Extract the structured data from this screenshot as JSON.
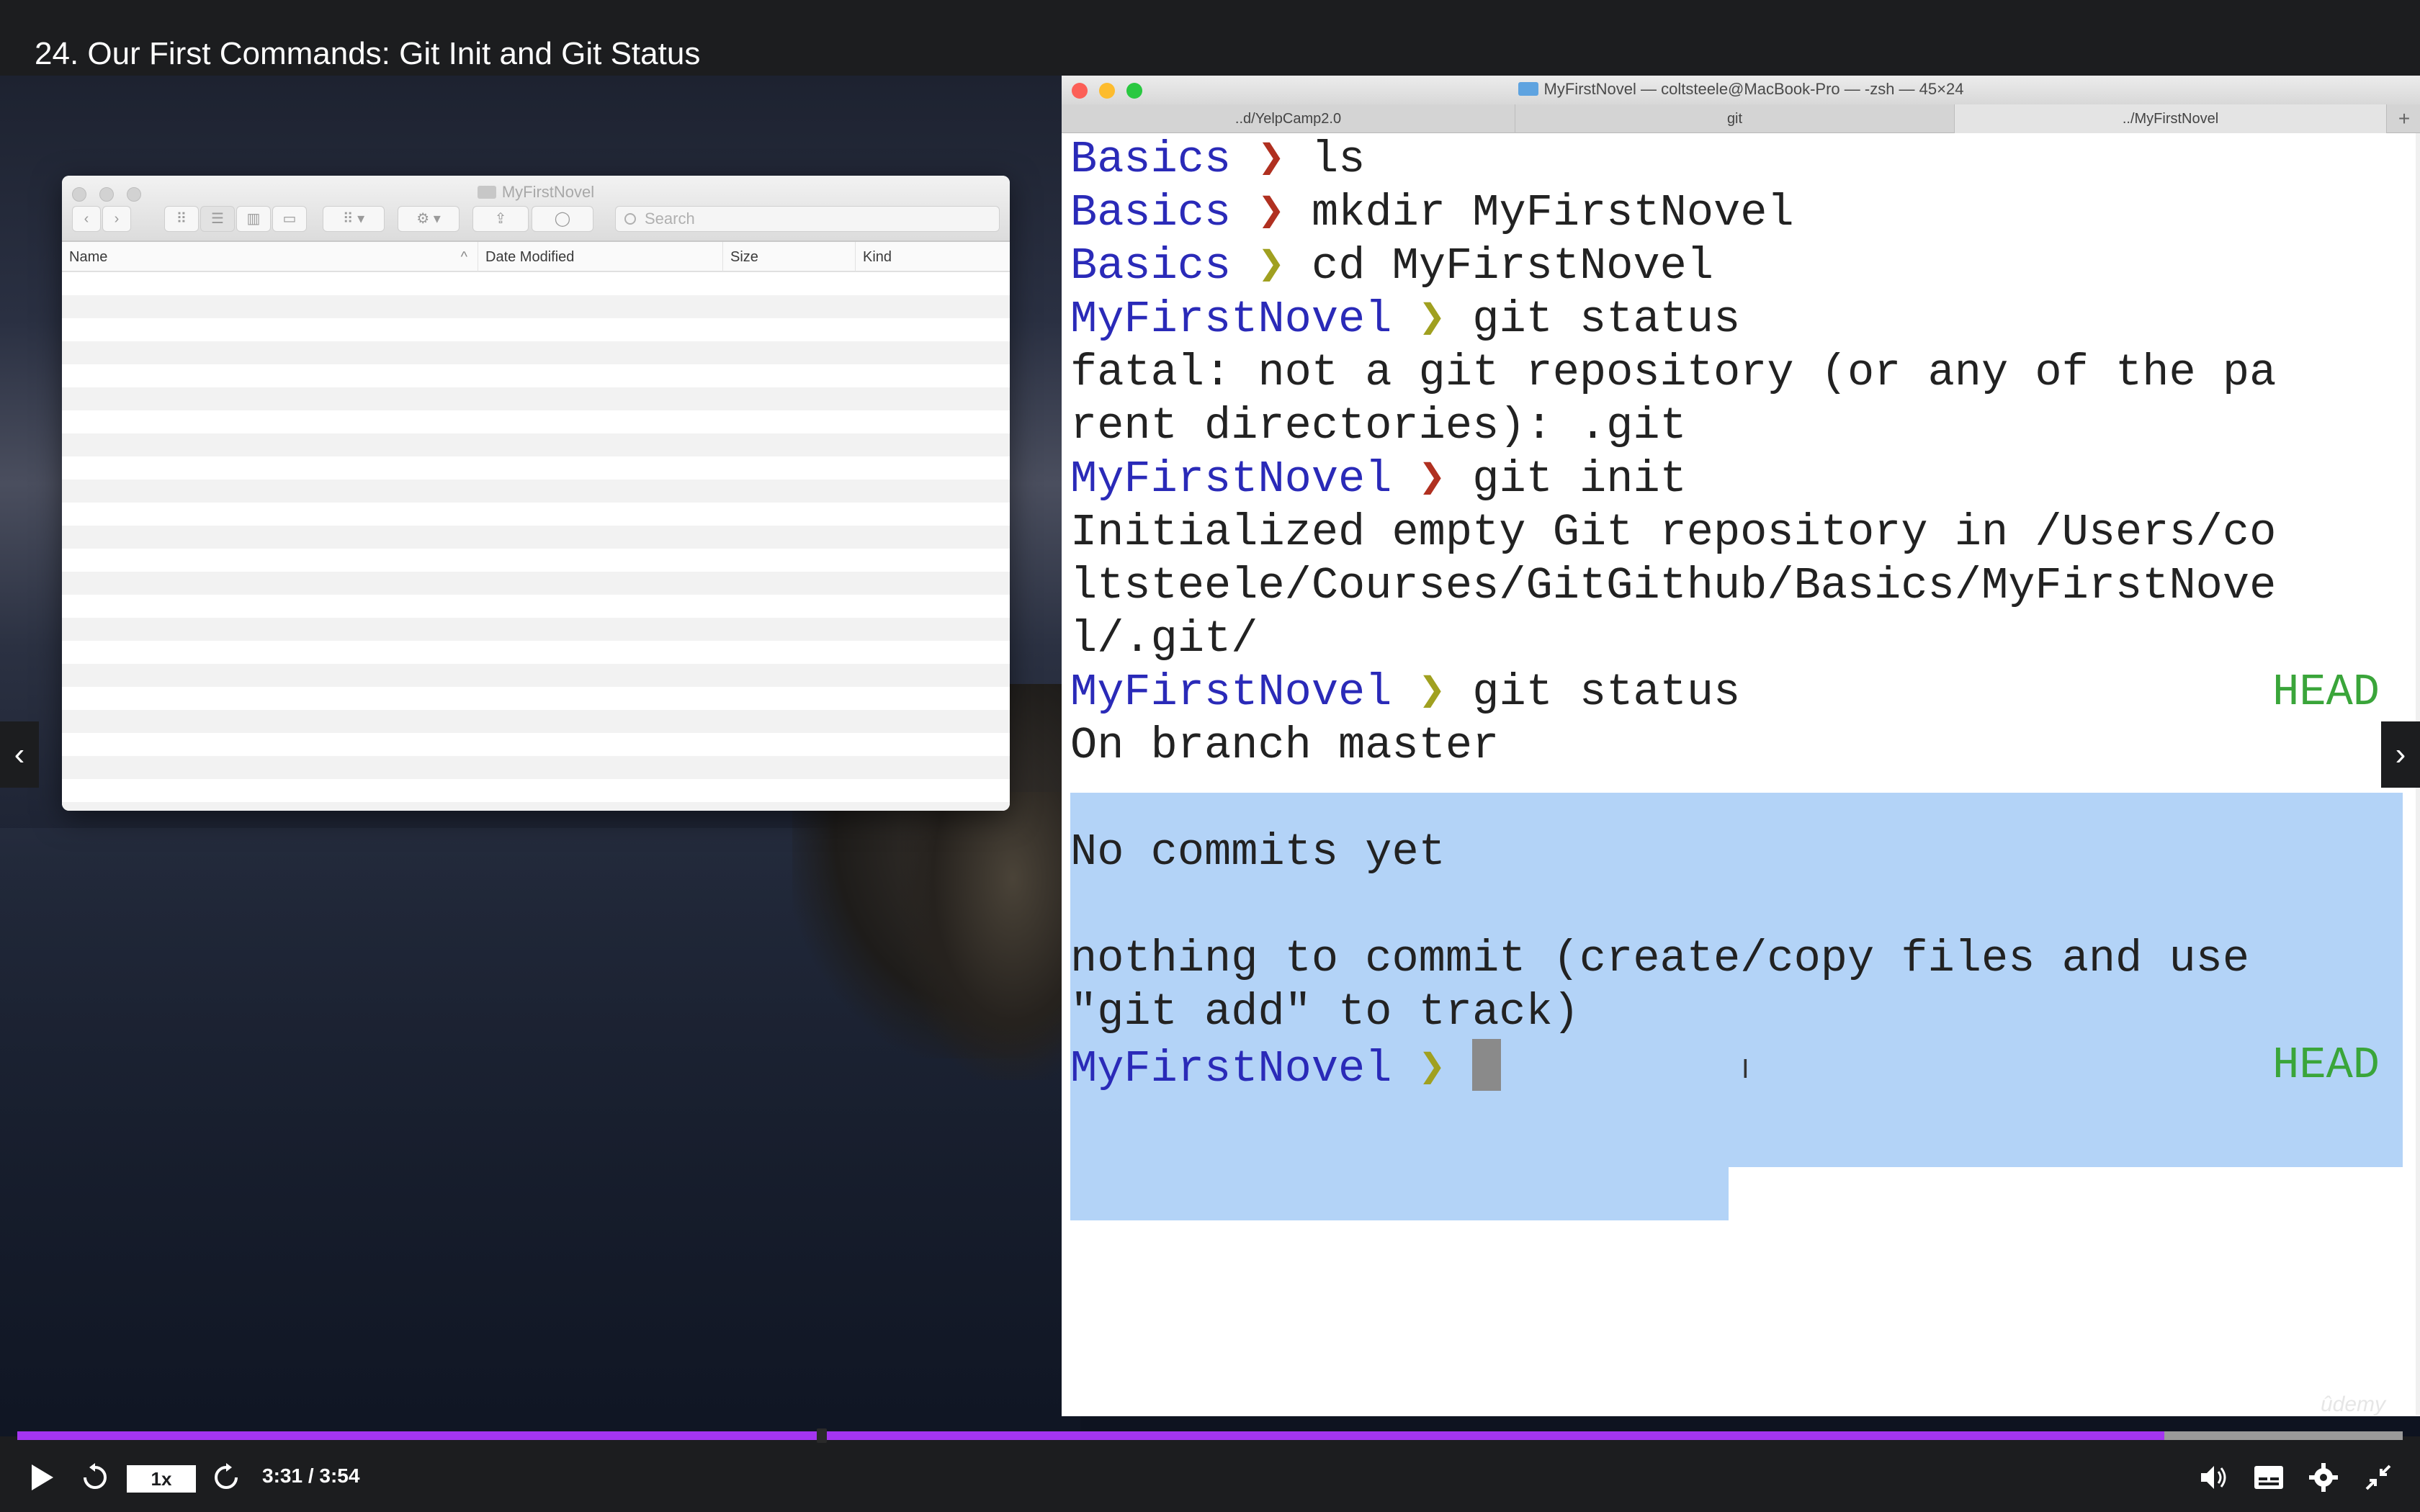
{
  "video": {
    "title": "24. Our First Commands: Git Init and Git Status",
    "time": "3:31 / 3:54",
    "speed": "1x",
    "progress_fraction": 0.9,
    "buffer_fraction": 1.0,
    "accent_color": "#a435f0",
    "watermark": "ûdemy"
  },
  "finder": {
    "title": "MyFirstNovel",
    "search_placeholder": "Search",
    "columns": [
      "Name",
      "Date Modified",
      "Size",
      "Kind"
    ],
    "sort_indicator": "^"
  },
  "terminal": {
    "title": "MyFirstNovel — coltsteele@MacBook-Pro — -zsh — 45×24",
    "tabs": [
      "..d/YelpCamp2.0",
      "git",
      "../MyFirstNovel"
    ],
    "tab_add": "+",
    "lines": [
      {
        "dir": "Basics",
        "arrow": "❯",
        "cmd": " ls"
      },
      {
        "dir": "Basics",
        "arrow": "❯",
        "cmd": " mkdir MyFirstNovel"
      },
      {
        "dir": "Basics",
        "arrow": "❯",
        "cmd": " cd MyFirstNovel"
      },
      {
        "dir": "MyFirstNovel",
        "arrow": "❯",
        "cmd": " git status"
      },
      {
        "text": "fatal: not a git repository (or any of the pa"
      },
      {
        "text": "rent directories): .git"
      },
      {
        "dir": "MyFirstNovel",
        "arrow": "❯",
        "cmd": " git init"
      },
      {
        "text": "Initialized empty Git repository in /Users/co"
      },
      {
        "text": "ltsteele/Courses/GitGithub/Basics/MyFirstNove"
      },
      {
        "text": "l/.git/"
      },
      {
        "dir": "MyFirstNovel",
        "arrow": "❯",
        "cmd": " git status",
        "right": "HEAD"
      },
      {
        "text": "On branch master"
      },
      {
        "text": ""
      },
      {
        "text": "No commits yet"
      },
      {
        "text": ""
      },
      {
        "text": "nothing to commit (create/copy files and use"
      },
      {
        "text": "\"git add\" to track)"
      },
      {
        "dir": "MyFirstNovel",
        "arrow": "❯",
        "cmd": " ",
        "right": "HEAD"
      }
    ],
    "colors": {
      "prompt_dir": "#2a2ab8",
      "arrow_red": "#b03020",
      "arrow_olive": "#a0a020",
      "head": "#3aa53a",
      "selection": "#b3d3f7"
    }
  }
}
